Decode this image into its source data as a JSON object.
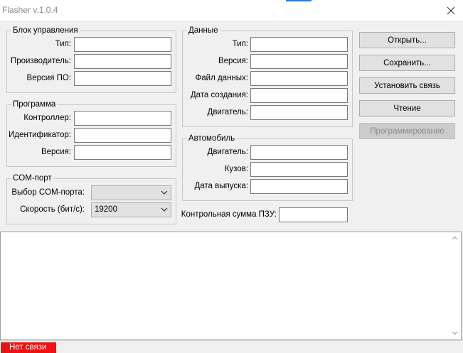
{
  "window": {
    "title": "Flasher v.1.0.4"
  },
  "control_block": {
    "legend": "Блок управления",
    "type_label": "Тип:",
    "manufacturer_label": "Производитель:",
    "sw_version_label": "Версия ПО:"
  },
  "program": {
    "legend": "Программа",
    "controller_label": "Контроллер:",
    "identifier_label": "Идентификатор:",
    "version_label": "Версия:"
  },
  "com_port": {
    "legend": "COM-порт",
    "port_label": "Выбор COM-порта:",
    "port_value": "",
    "speed_label": "Скорость (бит/с):",
    "speed_value": "19200"
  },
  "data": {
    "legend": "Данные",
    "type_label": "Тип:",
    "version_label": "Версия:",
    "file_label": "Файл данных:",
    "created_label": "Дата создания:",
    "engine_label": "Двигатель:"
  },
  "car": {
    "legend": "Автомобиль",
    "engine_label": "Двигатель:",
    "body_label": "Кузов:",
    "release_label": "Дата выпуска:"
  },
  "checksum": {
    "label": "Контрольная сумма ПЗУ:"
  },
  "buttons": {
    "open": "Открыть...",
    "save": "Сохранить...",
    "connect": "Установить связь",
    "read": "Чтение",
    "program": "Программирование"
  },
  "status": {
    "text": "Нет связи",
    "color": "#ee1111"
  }
}
